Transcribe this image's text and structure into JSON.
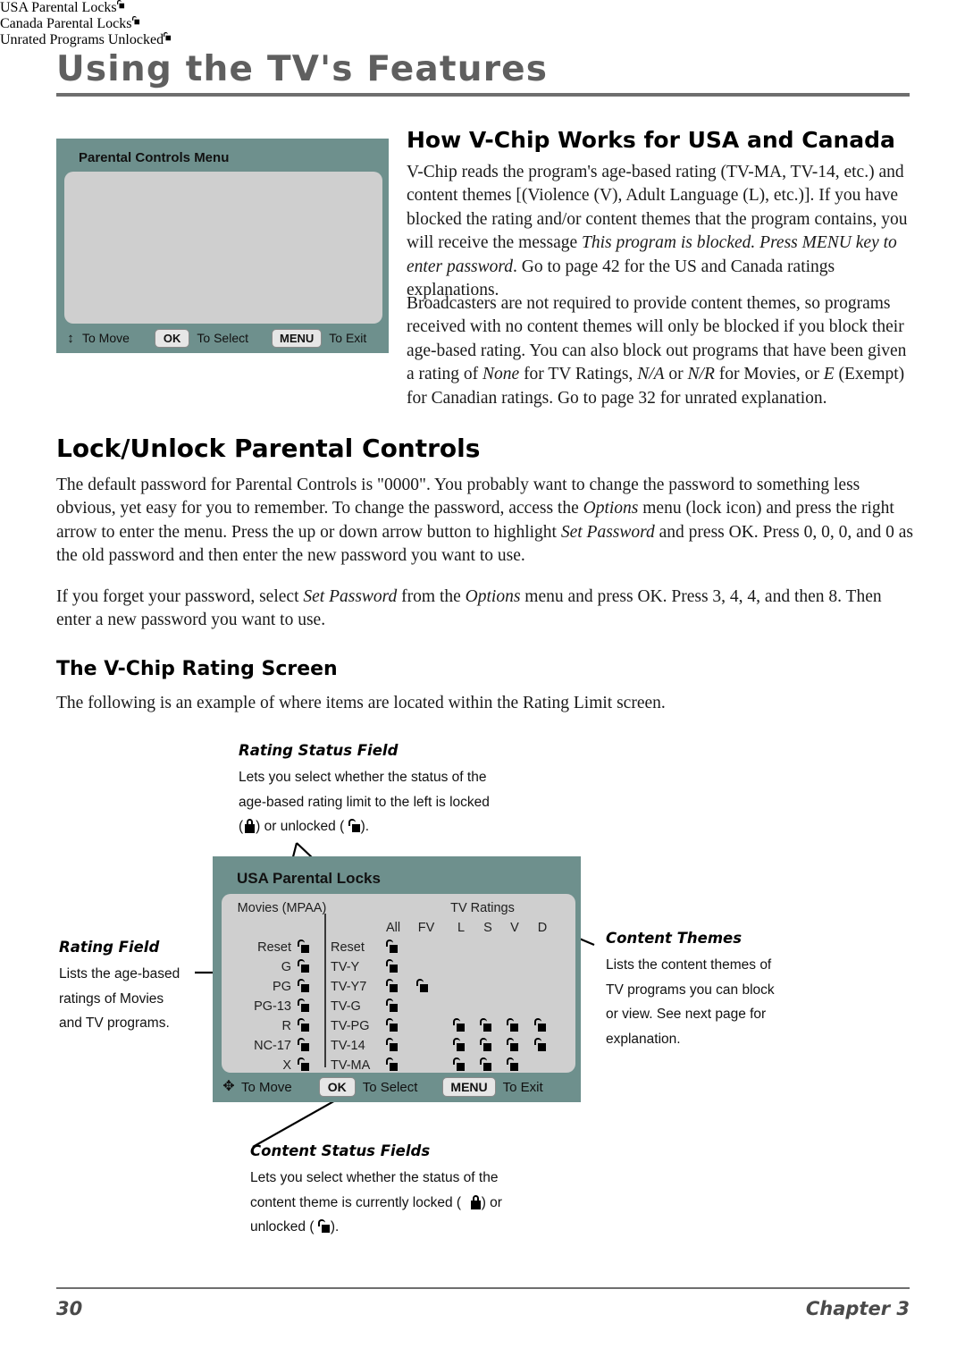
{
  "header": {
    "chapter_title": "Using the TV's Features"
  },
  "sections": {
    "how_vchip": {
      "title": "How V-Chip Works for USA and Canada",
      "p1_a": "V-Chip reads the program's age-based rating (TV-MA, TV-14, etc.) and content themes [(Violence (V), Adult Language (L), etc.)]. If you have blocked the rating and/or content themes that the program contains, you will receive the message ",
      "p1_i": "This program is blocked. Press MENU key to enter password",
      "p1_b": ". Go to page 42 for the US and Canada ratings explanations.",
      "p2_a": "Broadcasters are not required to provide content themes, so programs received with no content themes will only be blocked if you block their age-based rating. You can also block out programs that have been given a rating of ",
      "p2_i1": "None",
      "p2_b": " for TV Ratings, ",
      "p2_i2": "N/A",
      "p2_c": " or ",
      "p2_i3": "N/R",
      "p2_d": " for Movies, or ",
      "p2_i4": "E",
      "p2_e": " (Exempt) for Canadian ratings. Go to page 32 for unrated explanation."
    },
    "lock_unlock": {
      "title": "Lock/Unlock Parental Controls",
      "p1_a": "The default password for Parental Controls is \"0000\". You probably want to change the password to something less obvious, yet easy for you to remember. To change the password, access the ",
      "p1_i1": "Options",
      "p1_b": " menu (lock icon) and press the right arrow to enter the menu. Press the up or down arrow button to highlight ",
      "p1_i2": "Set Password",
      "p1_c": " and press OK. Press 0, 0, 0, and 0 as the old password and then enter the new password you want to use.",
      "p2_a": "If you forget your password, select ",
      "p2_i1": "Set Password",
      "p2_b": " from the ",
      "p2_i2": "Options",
      "p2_c": " menu and press OK. Press 3, 4, 4, and then 8. Then enter a new password you want to use."
    },
    "rating_screen": {
      "title": "The V-Chip Rating Screen",
      "p1": "The following is an example of where items are located within the Rating Limit screen."
    }
  },
  "parental_controls_menu": {
    "title": "Parental Controls Menu",
    "rows": [
      {
        "label": "USA Parental Locks",
        "value": "",
        "lock": "unlocked",
        "selected": true
      },
      {
        "label": "Canada Parental Locks",
        "value": "",
        "lock": "unlocked",
        "selected": false
      },
      {
        "label": "Unrated Programs",
        "value": "Unlocked",
        "lock": "unlocked",
        "selected": false
      }
    ],
    "footer": {
      "move_label": "To Move",
      "ok_key": "OK",
      "select_label": "To Select",
      "menu_key": "MENU",
      "exit_label": "To Exit"
    }
  },
  "usa_parental_locks": {
    "title": "USA Parental Locks",
    "movies_header": "Movies (MPAA)",
    "tv_header": "TV Ratings",
    "theme_columns": [
      "All",
      "FV",
      "L",
      "S",
      "V",
      "D"
    ],
    "movies_rows": [
      {
        "label": "Reset",
        "lock": "unlocked"
      },
      {
        "label": "G",
        "lock": "unlocked"
      },
      {
        "label": "PG",
        "lock": "unlocked"
      },
      {
        "label": "PG-13",
        "lock": "unlocked"
      },
      {
        "label": "R",
        "lock": "unlocked"
      },
      {
        "label": "NC-17",
        "lock": "unlocked"
      },
      {
        "label": "X",
        "lock": "unlocked"
      }
    ],
    "tv_rows": [
      {
        "label": "Reset",
        "all": "unlocked",
        "themes": [
          false,
          false,
          false,
          false,
          false
        ]
      },
      {
        "label": "TV-Y",
        "all": "unlocked",
        "themes": [
          false,
          false,
          false,
          false,
          false
        ]
      },
      {
        "label": "TV-Y7",
        "all": "unlocked",
        "themes": [
          true,
          false,
          false,
          false,
          false
        ]
      },
      {
        "label": "TV-G",
        "all": "unlocked",
        "themes": [
          false,
          false,
          false,
          false,
          false
        ]
      },
      {
        "label": "TV-PG",
        "all": "unlocked",
        "themes": [
          false,
          true,
          true,
          true,
          true
        ]
      },
      {
        "label": "TV-14",
        "all": "unlocked",
        "themes": [
          false,
          true,
          true,
          true,
          true
        ]
      },
      {
        "label": "TV-MA",
        "all": "unlocked",
        "themes": [
          false,
          true,
          true,
          true,
          false
        ]
      }
    ],
    "footer": {
      "move_label": "To Move",
      "ok_key": "OK",
      "select_label": "To Select",
      "menu_key": "MENU",
      "exit_label": "To Exit"
    }
  },
  "callouts": {
    "rating_status_field": {
      "title": "Rating Status Field",
      "line1": "Lets you select whether the status of the",
      "line2": "age-based rating limit to the left is locked",
      "line3_a": "(",
      "line3_b": ") or unlocked (",
      "line3_c": ")."
    },
    "rating_field": {
      "title": "Rating Field",
      "line1": "Lists the age-based",
      "line2": "ratings of Movies",
      "line3": "and TV programs."
    },
    "content_themes": {
      "title": "Content Themes",
      "line1": "Lists the content themes of",
      "line2": "TV programs you can block",
      "line3": "or view. See next page for",
      "line4": "explanation."
    },
    "content_status_fields": {
      "title": "Content Status Fields",
      "line1": "Lets you select whether the status of the",
      "line2_a": "content theme is currently locked (",
      "line2_b": ") or",
      "line3_a": "unlocked (",
      "line3_b": ")."
    }
  },
  "footer": {
    "page_number": "30",
    "chapter_label": "Chapter  3"
  },
  "colors": {
    "osd_teal": "#6e908d",
    "osd_panel_gray": "#cfcfcf",
    "rule_gray": "#6e6e6e",
    "title_gray": "#5f5f5f"
  }
}
